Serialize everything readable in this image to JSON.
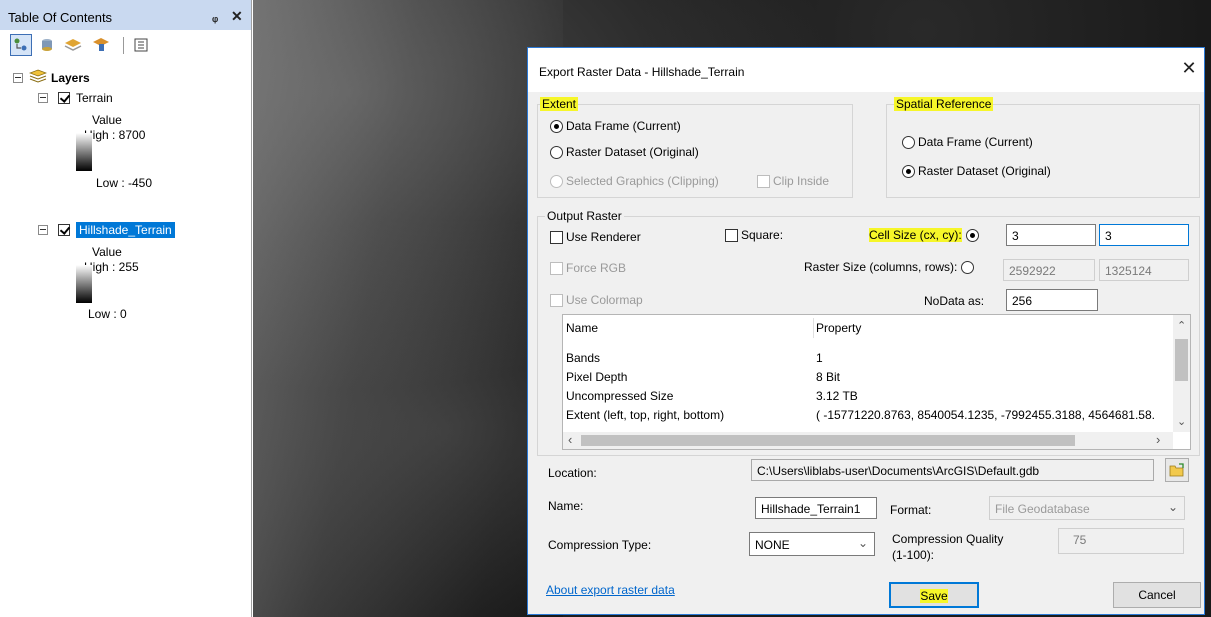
{
  "toc": {
    "title": "Table Of Contents",
    "pin_glyph": "ᵩ",
    "close_glyph": "✕",
    "toolbar_icons": [
      "list-by-drawing-order-icon",
      "list-by-source-icon",
      "list-by-visibility-icon",
      "list-by-selection-icon",
      "options-icon"
    ],
    "root_label": "Layers",
    "layers": [
      {
        "name": "Terrain",
        "checked": true,
        "legend_title": "Value",
        "high": "High : 8700",
        "low": "Low : -450",
        "selected": false
      },
      {
        "name": "Hillshade_Terrain",
        "checked": true,
        "legend_title": "Value",
        "high": "High : 255",
        "low": "Low : 0",
        "selected": true
      }
    ]
  },
  "dialog": {
    "title": "Export Raster Data - Hillshade_Terrain",
    "close_glyph": "✕",
    "extent": {
      "label": "Extent",
      "options": [
        {
          "label": "Data Frame (Current)",
          "selected": true,
          "enabled": true
        },
        {
          "label": "Raster Dataset (Original)",
          "selected": false,
          "enabled": true
        },
        {
          "label": "Selected Graphics (Clipping)",
          "selected": false,
          "enabled": false
        }
      ],
      "clip_inside_label": "Clip Inside"
    },
    "spatial_reference": {
      "label": "Spatial Reference",
      "options": [
        {
          "label": "Data Frame (Current)",
          "selected": false
        },
        {
          "label": "Raster Dataset (Original)",
          "selected": true
        }
      ]
    },
    "output_raster": {
      "label": "Output Raster",
      "use_renderer_label": "Use Renderer",
      "square_label": "Square:",
      "force_rgb_label": "Force RGB",
      "use_colormap_label": "Use Colormap",
      "cell_size_label": "Cell Size (cx, cy):",
      "cell_size_cx": "3",
      "cell_size_cy": "3",
      "raster_size_label": "Raster Size (columns, rows):",
      "raster_size_cols": "2592922",
      "raster_size_rows": "1325124",
      "nodata_label": "NoData as:",
      "nodata_value": "256"
    },
    "properties": {
      "header_name": "Name",
      "header_property": "Property",
      "rows": [
        {
          "name": "Bands",
          "value": "1"
        },
        {
          "name": "Pixel Depth",
          "value": "8 Bit"
        },
        {
          "name": "Uncompressed Size",
          "value": "3.12 TB"
        },
        {
          "name": "Extent (left, top, right, bottom)",
          "value": "( -15771220.8763, 8540054.1235, -7992455.3188, 4564681.58."
        }
      ]
    },
    "location_label": "Location:",
    "location_value": "C:\\Users\\liblabs-user\\Documents\\ArcGIS\\Default.gdb",
    "name_label": "Name:",
    "name_value": "Hillshade_Terrain1",
    "format_label": "Format:",
    "format_value": "File Geodatabase",
    "compression_type_label": "Compression Type:",
    "compression_type_value": "NONE",
    "compression_quality_label_1": "Compression Quality",
    "compression_quality_label_2": "(1-100):",
    "compression_quality_value": "75",
    "about_link": "About export raster data",
    "save_label": "Save",
    "cancel_label": "Cancel"
  },
  "colors": {
    "highlight": "#f6f629",
    "selection": "#0078d7",
    "toc_title_bar": "#c9d9f0",
    "link": "#0066cc"
  }
}
